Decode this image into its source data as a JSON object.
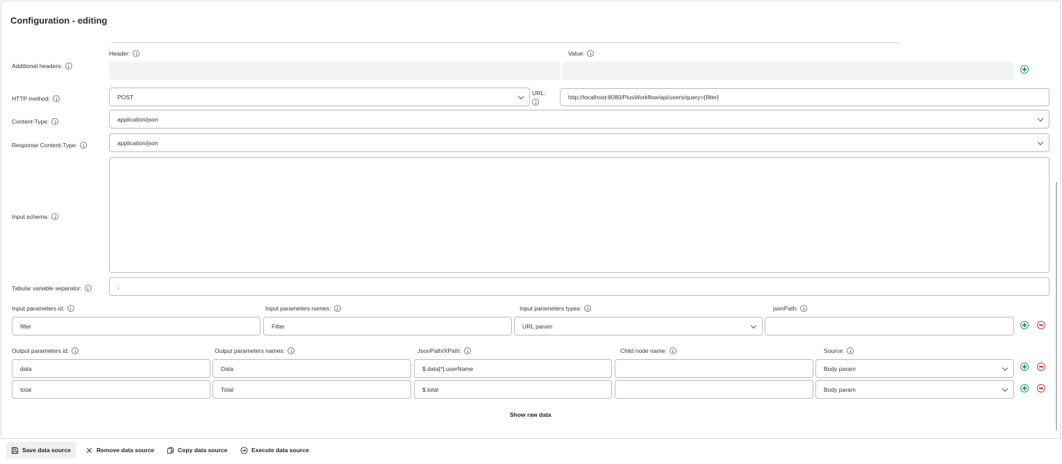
{
  "title": "Configuration - editing",
  "headers": {
    "label": "Additional headers:",
    "header_label": "Header:",
    "value_label": "Value:"
  },
  "http": {
    "method_label": "HTTP method:",
    "method_value": "POST",
    "url_label": "URL:",
    "url_value": "http://localhost:8080/PlusWorkflow/api/users/query={filter}"
  },
  "content_type": {
    "label": "Content-Type:",
    "value": "application/json"
  },
  "response_content_type": {
    "label": "Response Content-Type:",
    "value": "application/json"
  },
  "input_schema": {
    "label": "Input schema:",
    "value": ""
  },
  "tabular_separator": {
    "label": "Tabular variable separator:",
    "value": ";"
  },
  "input_params": {
    "headers": [
      "Input parameters id:",
      "Input parameters names:",
      "Input parameters types:",
      "jsonPath:"
    ],
    "rows": [
      {
        "id": "filter",
        "name": "Filter",
        "type": "URL param",
        "json_path": ""
      }
    ]
  },
  "output_params": {
    "headers": [
      "Output parameters id:",
      "Output parameters names:",
      "JsonPath/XPath:",
      "Child node name:",
      "Source:"
    ],
    "rows": [
      {
        "id": "data",
        "name": "Data",
        "path": "$.data[*].userName",
        "child": "",
        "source": "Body param"
      },
      {
        "id": "total",
        "name": "Total",
        "path": "$.total",
        "child": "",
        "source": "Body param"
      }
    ]
  },
  "show_raw": "Show raw data",
  "actions": {
    "save": "Save data source",
    "remove": "Remove data source",
    "copy": "Copy data source",
    "execute": "Execute data source"
  },
  "colors": {
    "add": "#1e9e4f",
    "remove": "#d9362b"
  },
  "icons": [
    "info-icon",
    "chevron-down-icon",
    "add-circle-icon",
    "remove-circle-icon",
    "save-icon",
    "close-icon",
    "copy-icon",
    "execute-icon"
  ]
}
